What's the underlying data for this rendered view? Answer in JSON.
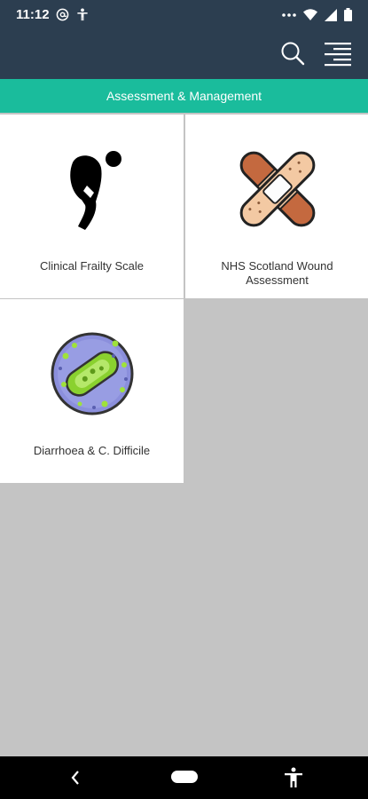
{
  "status_bar": {
    "time": "11:12",
    "icons_left": [
      "at-sign-icon",
      "person-icon"
    ],
    "icons_right": [
      "more-dots-icon",
      "wifi-icon",
      "signal-icon",
      "battery-icon"
    ]
  },
  "app_bar": {
    "icons": [
      "search-icon",
      "menu-icon"
    ]
  },
  "section": {
    "title": "Assessment & Management"
  },
  "tiles": [
    {
      "label": "Clinical Frailty Scale",
      "icon": "frailty-person-icon"
    },
    {
      "label": "NHS Scotland Wound Assessment",
      "icon": "bandage-icon"
    },
    {
      "label": "Diarrhoea & C. Difficile",
      "icon": "bacteria-icon"
    }
  ],
  "nav_bar": {
    "icons": [
      "back-icon",
      "home-icon",
      "accessibility-icon"
    ]
  },
  "colors": {
    "app_bar": "#2c3e50",
    "accent": "#1abc9c",
    "background": "#c4c4c4"
  }
}
